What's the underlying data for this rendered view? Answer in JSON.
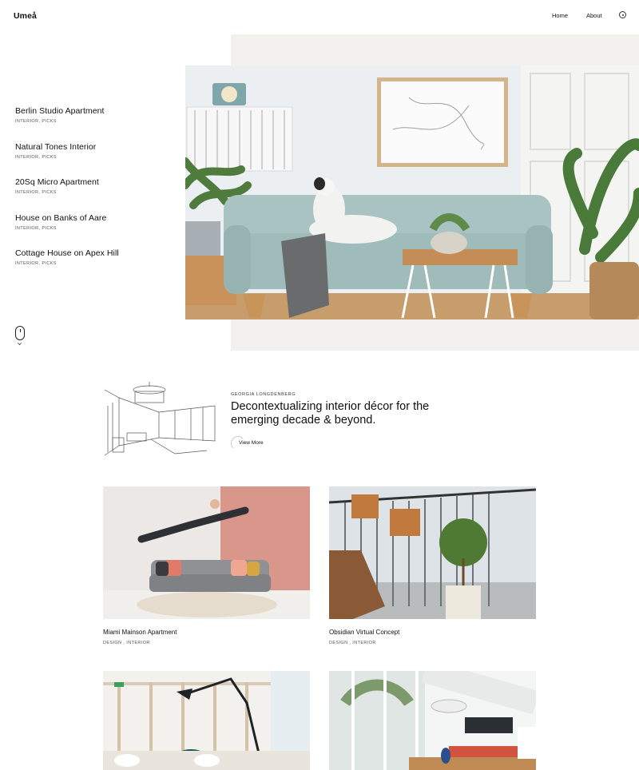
{
  "header": {
    "logo": "Umeå",
    "nav": [
      {
        "label": "Home"
      },
      {
        "label": "About"
      }
    ]
  },
  "projects": [
    {
      "title": "Berlin Studio Apartment",
      "tags": "INTERIOR, PICKS"
    },
    {
      "title": "Natural Tones Interior",
      "tags": "INTERIOR, PICKS"
    },
    {
      "title": "20Sq Micro Apartment",
      "tags": "INTERIOR, PICKS"
    },
    {
      "title": "House on Banks of Aare",
      "tags": "INTERIOR, PICKS"
    },
    {
      "title": "Cottage House on Apex Hill",
      "tags": "INTERIOR, PICKS"
    }
  ],
  "intro": {
    "author": "GEORGIA LONGDENBERG",
    "heading_line1": "Decontextualizing interior décor for the",
    "heading_line2": "emerging decade & beyond.",
    "button_label": "View More"
  },
  "portfolio": [
    {
      "title": "Miami Mainson Apartment",
      "tags": "DESIGN , INTERIOR"
    },
    {
      "title": "Obsidian Virtual Concept",
      "tags": "DESIGN , INTERIOR"
    },
    {
      "title": "",
      "tags": ""
    },
    {
      "title": "",
      "tags": ""
    }
  ],
  "colors": {
    "hero_background": "#f3f1ed",
    "sofa": "#a9c3c2",
    "accent_wall": "#d9968a"
  }
}
